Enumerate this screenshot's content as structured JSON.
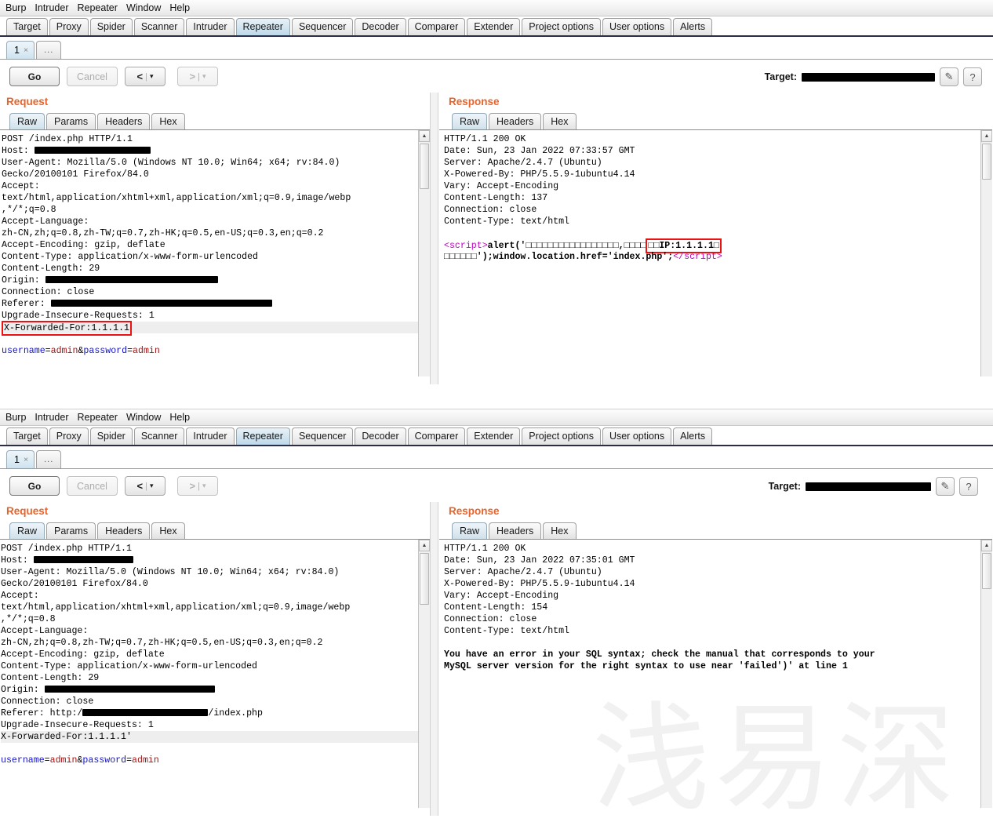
{
  "app": {
    "menu": [
      "Burp",
      "Intruder",
      "Repeater",
      "Window",
      "Help"
    ],
    "main_tabs": [
      "Target",
      "Proxy",
      "Spider",
      "Scanner",
      "Intruder",
      "Repeater",
      "Sequencer",
      "Decoder",
      "Comparer",
      "Extender",
      "Project options",
      "User options",
      "Alerts"
    ],
    "selected_main_tab": "Repeater",
    "repeater_tabs": {
      "number": "1",
      "close": "×",
      "more": "..."
    },
    "controls": {
      "go": "Go",
      "cancel": "Cancel",
      "back_arrow": "<",
      "forward_arrow": ">",
      "separator": "|",
      "caret": "▾",
      "target_label": "Target:",
      "target_value_redacted": true,
      "edit_icon": "✎",
      "help_icon": "?"
    },
    "request_pane": {
      "title": "Request",
      "tabs": [
        "Raw",
        "Params",
        "Headers",
        "Hex"
      ],
      "selected": "Raw"
    },
    "response_pane": {
      "title": "Response",
      "tabs": [
        "Raw",
        "Headers",
        "Hex"
      ],
      "selected": "Raw"
    },
    "watermark": "浅易深"
  },
  "top_window": {
    "request_lines": [
      {
        "text": "POST /index.php HTTP/1.1"
      },
      {
        "text": "Host: ",
        "redact_w": 148
      },
      {
        "text": "User-Agent: Mozilla/5.0 (Windows NT 10.0; Win64; x64; rv:84.0)"
      },
      {
        "text": "Gecko/20100101 Firefox/84.0"
      },
      {
        "text": "Accept:"
      },
      {
        "text": "text/html,application/xhtml+xml,application/xml;q=0.9,image/webp"
      },
      {
        "text": ",*/*;q=0.8"
      },
      {
        "text": "Accept-Language:"
      },
      {
        "text": "zh-CN,zh;q=0.8,zh-TW;q=0.7,zh-HK;q=0.5,en-US;q=0.3,en;q=0.2"
      },
      {
        "text": "Accept-Encoding: gzip, deflate"
      },
      {
        "text": "Content-Type: application/x-www-form-urlencoded"
      },
      {
        "text": "Content-Length: 29"
      },
      {
        "text": "Origin: ",
        "redact_w": 220
      },
      {
        "text": "Connection: close"
      },
      {
        "text": "Referer: ",
        "redact_w": 282
      },
      {
        "text": "Upgrade-Insecure-Requests: 1"
      },
      {
        "text": "X-Forwarded-For:1.1.1.1",
        "highlight": true,
        "boxed": true
      },
      {
        "text": ""
      },
      {
        "text": "username=admin&password=admin",
        "body": true
      }
    ],
    "response_lines": [
      {
        "text": "HTTP/1.1 200 OK"
      },
      {
        "text": "Date: Sun, 23 Jan 2022 07:33:57 GMT"
      },
      {
        "text": "Server: Apache/2.4.7 (Ubuntu)"
      },
      {
        "text": "X-Powered-By: PHP/5.5.9-1ubuntu4.14"
      },
      {
        "text": "Vary: Accept-Encoding"
      },
      {
        "text": "Content-Length: 137"
      },
      {
        "text": "Connection: close"
      },
      {
        "text": "Content-Type: text/html"
      },
      {
        "text": ""
      }
    ],
    "response_script": {
      "open_tag_lt": "<",
      "open_tag_name": "script",
      "open_tag_gt": ">",
      "fn": "alert('",
      "tofu_1": "□□□□□□□□□□□□□□□□□",
      "comma": ",",
      "tofu_2": "□□□□",
      "boxed_text": "□□IP:1.1.1.1□",
      "line2_tofu": "□□□□□□",
      "line2_mid": "');window.location.href='index.php'",
      "line2_semi": ";",
      "close_tag_lt": "</",
      "close_tag_name": "script",
      "close_tag_gt": ">"
    }
  },
  "bottom_window": {
    "request_lines": [
      {
        "text": "POST /index.php HTTP/1.1"
      },
      {
        "text": "Host: ",
        "redact_w": 127
      },
      {
        "text": "User-Agent: Mozilla/5.0 (Windows NT 10.0; Win64; x64; rv:84.0)"
      },
      {
        "text": "Gecko/20100101 Firefox/84.0"
      },
      {
        "text": "Accept:"
      },
      {
        "text": "text/html,application/xhtml+xml,application/xml;q=0.9,image/webp"
      },
      {
        "text": ",*/*;q=0.8"
      },
      {
        "text": "Accept-Language:"
      },
      {
        "text": "zh-CN,zh;q=0.8,zh-TW;q=0.7,zh-HK;q=0.5,en-US;q=0.3,en;q=0.2"
      },
      {
        "text": "Accept-Encoding: gzip, deflate"
      },
      {
        "text": "Content-Type: application/x-www-form-urlencoded"
      },
      {
        "text": "Content-Length: 29"
      },
      {
        "text": "Origin: ",
        "redact_w": 217
      },
      {
        "text": "Connection: close"
      },
      {
        "text": "Referer: http:/",
        "redact_w": 160,
        "suffix": "/index.php"
      },
      {
        "text": "Upgrade-Insecure-Requests: 1"
      },
      {
        "text": "X-Forwarded-For:1.1.1.1'",
        "highlight": true
      },
      {
        "text": ""
      },
      {
        "text": "username=admin&password=admin",
        "body": true
      }
    ],
    "response_lines": [
      {
        "text": "HTTP/1.1 200 OK"
      },
      {
        "text": "Date: Sun, 23 Jan 2022 07:35:01 GMT"
      },
      {
        "text": "Server: Apache/2.4.7 (Ubuntu)"
      },
      {
        "text": "X-Powered-By: PHP/5.5.9-1ubuntu4.14"
      },
      {
        "text": "Vary: Accept-Encoding"
      },
      {
        "text": "Content-Length: 154"
      },
      {
        "text": "Connection: close"
      },
      {
        "text": "Content-Type: text/html"
      },
      {
        "text": ""
      }
    ],
    "response_error": [
      "You have an error in your SQL syntax; check the manual that corresponds to your",
      "MySQL server version for the right syntax to use near 'failed')' at line 1"
    ]
  },
  "colors": {
    "accent_orange": "#e8632a",
    "highlight_box": "#ee1111",
    "selected_tab": "#cfe3ef",
    "keyword_blue": "#1414c8",
    "keyword_red": "#a01414",
    "keyword_magenta": "#c000c0",
    "watermark": "#f1f1f1"
  }
}
